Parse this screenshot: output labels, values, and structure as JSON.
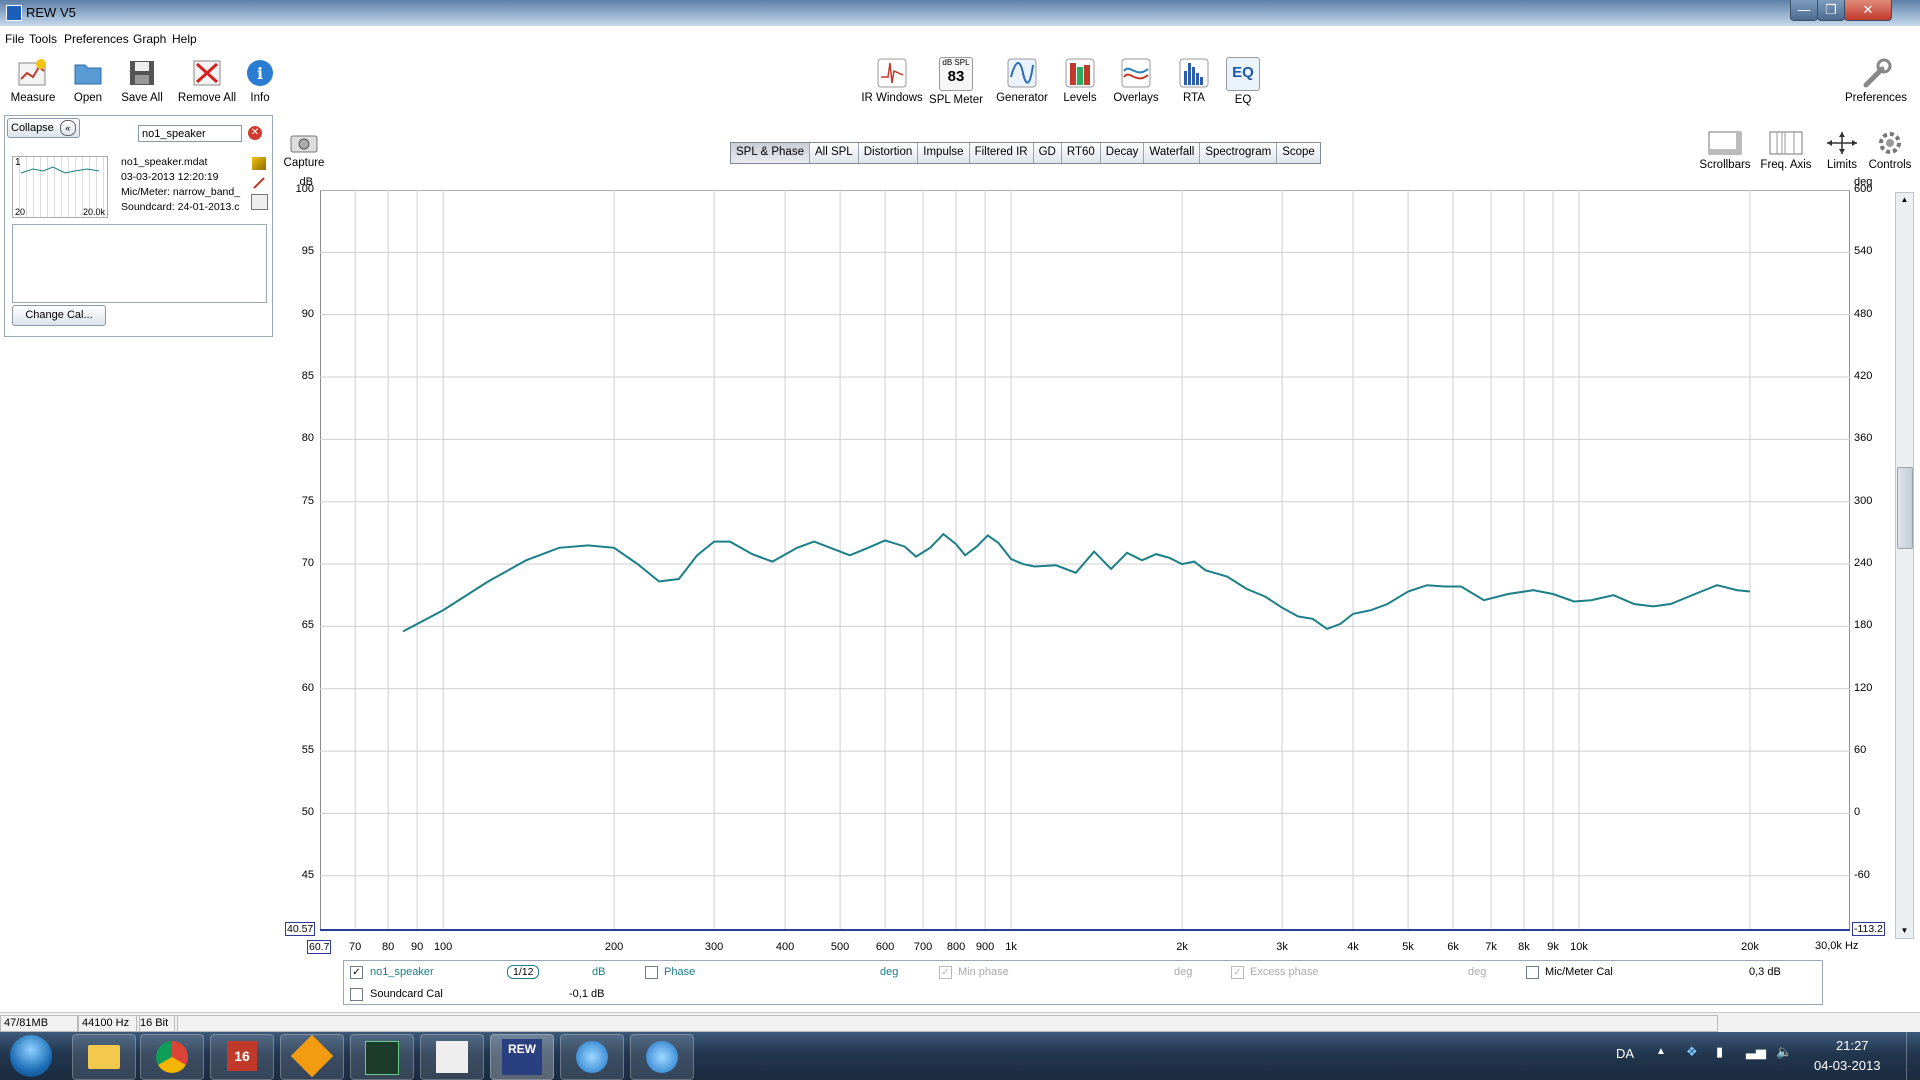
{
  "window": {
    "title": "REW V5",
    "buttons": [
      "minimize",
      "maximize",
      "close"
    ]
  },
  "menu": [
    "File",
    "Tools",
    "Preferences",
    "Graph",
    "Help"
  ],
  "toolbar_left": [
    {
      "label": "Measure",
      "icon": "measure-icon"
    },
    {
      "label": "Open",
      "icon": "folder-icon"
    },
    {
      "label": "Save All",
      "icon": "save-icon"
    },
    {
      "label": "Remove All",
      "icon": "remove-icon"
    },
    {
      "label": "Info",
      "icon": "info-icon"
    }
  ],
  "toolbar_center": [
    {
      "label": "IR Windows",
      "icon": "ir-windows-icon"
    },
    {
      "label": "SPL Meter",
      "icon": "spl-meter-icon",
      "badge_top": "dB SPL",
      "badge_value": "83"
    },
    {
      "label": "Generator",
      "icon": "generator-icon"
    },
    {
      "label": "Levels",
      "icon": "levels-icon"
    },
    {
      "label": "Overlays",
      "icon": "overlays-icon"
    },
    {
      "label": "RTA",
      "icon": "rta-icon"
    },
    {
      "label": "EQ",
      "icon": "eq-icon",
      "badge_value": "EQ"
    }
  ],
  "toolbar_right": {
    "label": "Preferences",
    "icon": "wrench-icon"
  },
  "measurements_panel": {
    "collapse_label": "Collapse",
    "name_field": "no1_speaker",
    "item": {
      "index": "1",
      "thumb_left": "20",
      "thumb_right": "20.0k",
      "filename": "no1_speaker.mdat",
      "date": "03-03-2013 12:20:19",
      "mic": "Mic/Meter: narrow_band_",
      "soundcard": "Soundcard: 24-01-2013.c"
    },
    "change_cal_label": "Change Cal..."
  },
  "capture_label": "Capture",
  "graph_tabs": [
    {
      "label": "SPL & Phase",
      "active": true
    },
    {
      "label": "All SPL",
      "active": false
    },
    {
      "label": "Distortion",
      "active": false
    },
    {
      "label": "Impulse",
      "active": false
    },
    {
      "label": "Filtered IR",
      "active": false
    },
    {
      "label": "GD",
      "active": false
    },
    {
      "label": "RT60",
      "active": false
    },
    {
      "label": "Decay",
      "active": false
    },
    {
      "label": "Waterfall",
      "active": false
    },
    {
      "label": "Spectrogram",
      "active": false
    },
    {
      "label": "Scope",
      "active": false
    }
  ],
  "graph_controls": [
    {
      "label": "Scrollbars",
      "icon": "scrollbars-icon"
    },
    {
      "label": "Freq. Axis",
      "icon": "freq-axis-icon"
    },
    {
      "label": "Limits",
      "icon": "limits-icon"
    },
    {
      "label": "Controls",
      "icon": "gear-icon"
    }
  ],
  "chart_data": {
    "type": "line",
    "x_scale": "log",
    "xlim": [
      60.7,
      30000
    ],
    "ylim": [
      40.57,
      100
    ],
    "y2lim": [
      -113.2,
      600
    ],
    "ylabel": "dB",
    "y2label": "deg",
    "y_ticks": [
      100,
      95,
      90,
      85,
      80,
      75,
      70,
      65,
      60,
      55,
      50,
      45
    ],
    "y2_ticks": [
      600,
      540,
      480,
      420,
      360,
      300,
      240,
      180,
      120,
      60,
      0,
      -60
    ],
    "x_ticks": [
      {
        "v": 70,
        "t": "70"
      },
      {
        "v": 80,
        "t": "80"
      },
      {
        "v": 90,
        "t": "90"
      },
      {
        "v": 100,
        "t": "100"
      },
      {
        "v": 200,
        "t": "200"
      },
      {
        "v": 300,
        "t": "300"
      },
      {
        "v": 400,
        "t": "400"
      },
      {
        "v": 500,
        "t": "500"
      },
      {
        "v": 600,
        "t": "600"
      },
      {
        "v": 700,
        "t": "700"
      },
      {
        "v": 800,
        "t": "800"
      },
      {
        "v": 900,
        "t": "900"
      },
      {
        "v": 1000,
        "t": "1k"
      },
      {
        "v": 2000,
        "t": "2k"
      },
      {
        "v": 3000,
        "t": "3k"
      },
      {
        "v": 4000,
        "t": "4k"
      },
      {
        "v": 5000,
        "t": "5k"
      },
      {
        "v": 6000,
        "t": "6k"
      },
      {
        "v": 7000,
        "t": "7k"
      },
      {
        "v": 8000,
        "t": "8k"
      },
      {
        "v": 9000,
        "t": "9k"
      },
      {
        "v": 10000,
        "t": "10k"
      },
      {
        "v": 20000,
        "t": "20k"
      }
    ],
    "x_min_label": "60.7",
    "x_max_label": "30,0k Hz",
    "y_min_label": "40.57",
    "y2_min_label": "-113.2",
    "grid": true,
    "series": [
      {
        "name": "no1_speaker",
        "color": "#1a7f86",
        "points": [
          [
            85,
            64.6
          ],
          [
            100,
            66.3
          ],
          [
            120,
            68.6
          ],
          [
            140,
            70.3
          ],
          [
            160,
            71.3
          ],
          [
            180,
            71.5
          ],
          [
            200,
            71.3
          ],
          [
            220,
            70.0
          ],
          [
            240,
            68.6
          ],
          [
            260,
            68.8
          ],
          [
            280,
            70.7
          ],
          [
            300,
            71.8
          ],
          [
            320,
            71.8
          ],
          [
            350,
            70.8
          ],
          [
            380,
            70.2
          ],
          [
            420,
            71.3
          ],
          [
            450,
            71.8
          ],
          [
            500,
            71.0
          ],
          [
            520,
            70.7
          ],
          [
            560,
            71.3
          ],
          [
            600,
            71.9
          ],
          [
            650,
            71.4
          ],
          [
            680,
            70.6
          ],
          [
            720,
            71.3
          ],
          [
            760,
            72.4
          ],
          [
            800,
            71.6
          ],
          [
            830,
            70.7
          ],
          [
            870,
            71.4
          ],
          [
            910,
            72.3
          ],
          [
            950,
            71.7
          ],
          [
            1000,
            70.4
          ],
          [
            1050,
            70.0
          ],
          [
            1100,
            69.8
          ],
          [
            1200,
            69.9
          ],
          [
            1300,
            69.3
          ],
          [
            1400,
            71.0
          ],
          [
            1500,
            69.6
          ],
          [
            1600,
            70.9
          ],
          [
            1700,
            70.3
          ],
          [
            1800,
            70.8
          ],
          [
            1900,
            70.5
          ],
          [
            2000,
            70.0
          ],
          [
            2100,
            70.2
          ],
          [
            2200,
            69.5
          ],
          [
            2400,
            69.0
          ],
          [
            2600,
            68.0
          ],
          [
            2800,
            67.4
          ],
          [
            3000,
            66.5
          ],
          [
            3200,
            65.8
          ],
          [
            3400,
            65.6
          ],
          [
            3600,
            64.8
          ],
          [
            3800,
            65.2
          ],
          [
            4000,
            66.0
          ],
          [
            4300,
            66.3
          ],
          [
            4600,
            66.8
          ],
          [
            5000,
            67.8
          ],
          [
            5400,
            68.3
          ],
          [
            5800,
            68.2
          ],
          [
            6200,
            68.2
          ],
          [
            6800,
            67.1
          ],
          [
            7500,
            67.6
          ],
          [
            8300,
            67.9
          ],
          [
            9000,
            67.6
          ],
          [
            9800,
            67.0
          ],
          [
            10500,
            67.1
          ],
          [
            11500,
            67.5
          ],
          [
            12500,
            66.8
          ],
          [
            13500,
            66.6
          ],
          [
            14500,
            66.8
          ],
          [
            16000,
            67.6
          ],
          [
            17500,
            68.3
          ],
          [
            19000,
            67.9
          ],
          [
            20000,
            67.8
          ]
        ]
      }
    ]
  },
  "legend": {
    "rows": [
      {
        "checked": true,
        "name": "no1_speaker",
        "smoothing": "1/12",
        "unit": "dB",
        "phase_label": "Phase",
        "phase_unit": "deg",
        "min_phase_label": "Min phase",
        "min_phase_unit": "deg",
        "excess_phase_label": "Excess phase",
        "excess_phase_unit": "deg",
        "mic_cal_label": "Mic/Meter Cal",
        "mic_cal_value": "0,3 dB"
      },
      {
        "checked": false,
        "name": "Soundcard Cal",
        "value": "-0,1 dB"
      }
    ]
  },
  "status": {
    "memory": "47/81MB",
    "sample_rate": "44100 Hz",
    "bits": "16 Bit"
  },
  "taskbar": {
    "apps": [
      "start-orb",
      "explorer",
      "chrome",
      "app-16",
      "app-lightning",
      "app-media",
      "app-chart",
      "rew",
      "itunes",
      "itunes-2"
    ],
    "language": "DA",
    "time": "21:27",
    "date": "04-03-2013"
  }
}
